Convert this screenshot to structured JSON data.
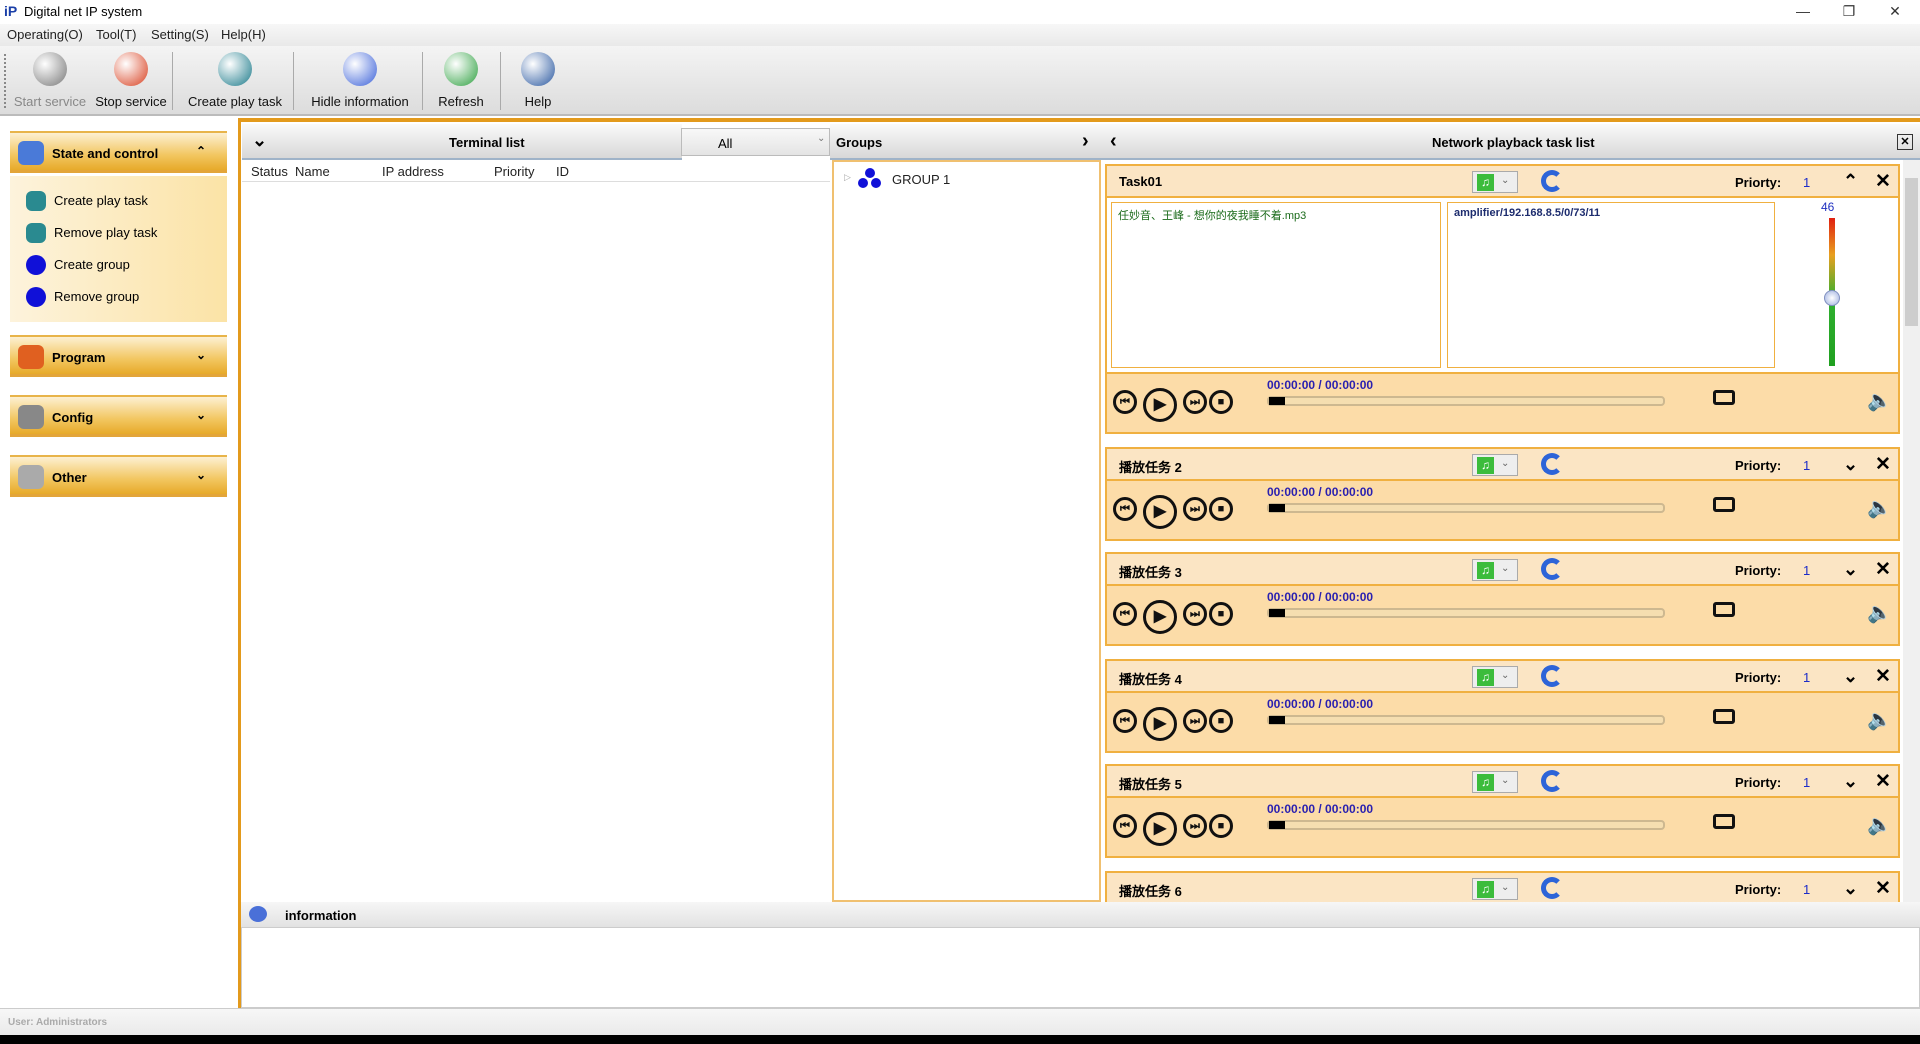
{
  "window": {
    "logo": "iP",
    "title": "Digital net IP system",
    "controls": [
      "—",
      "❐",
      "✕"
    ]
  },
  "menu": [
    "Operating(O)",
    "Tool(T)",
    "Setting(S)",
    "Help(H)"
  ],
  "toolbar": [
    {
      "label": "Start service",
      "icon": "start-service-icon",
      "disabled": true
    },
    {
      "label": "Stop service",
      "icon": "stop-service-icon"
    },
    {
      "label": "Create play task",
      "icon": "play-icon"
    },
    {
      "label": "Hidle information",
      "icon": "info-icon"
    },
    {
      "label": "Refresh",
      "icon": "refresh-icon"
    },
    {
      "label": "Help",
      "icon": "help-book-icon"
    }
  ],
  "sidebar": {
    "sections": [
      {
        "label": "State and control",
        "expanded": true,
        "chev": "⌃"
      },
      {
        "label": "Program",
        "chev": "⌄"
      },
      {
        "label": "Config",
        "chev": "⌄"
      },
      {
        "label": "Other",
        "chev": "⌄"
      }
    ],
    "items": [
      "Create play task",
      "Remove play task",
      "Create group",
      "Remove group"
    ]
  },
  "terminal": {
    "title": "Terminal list",
    "filter": "All",
    "columns": [
      "Status",
      "Name",
      "IP address",
      "Priority",
      "ID"
    ]
  },
  "groups": {
    "title": "Groups",
    "items": [
      "GROUP 1"
    ]
  },
  "tasklist": {
    "title": "Network playback task list",
    "priority_label": "Priorty:",
    "tasks": [
      {
        "name": "Task01",
        "priority": "1",
        "expanded": true,
        "file": "任妙音、王峰 - 想你的夜我睡不着.mp3",
        "device": "amplifier/192.168.8.5/0/73/11",
        "volume": 46,
        "time": "00:00:00 / 00:00:00"
      },
      {
        "name": "播放任务 2",
        "priority": "1",
        "time": "00:00:00 / 00:00:00"
      },
      {
        "name": "播放任务 3",
        "priority": "1",
        "time": "00:00:00 / 00:00:00"
      },
      {
        "name": "播放任务 4",
        "priority": "1",
        "time": "00:00:00 / 00:00:00"
      },
      {
        "name": "播放任务 5",
        "priority": "1",
        "time": "00:00:00 / 00:00:00"
      },
      {
        "name": "播放任务 6",
        "priority": "1"
      }
    ]
  },
  "info": {
    "title": "information"
  },
  "status": {
    "user": "User: Administrators"
  },
  "colors": {
    "accent": "#e39a1c",
    "card": "#fcdca8"
  }
}
